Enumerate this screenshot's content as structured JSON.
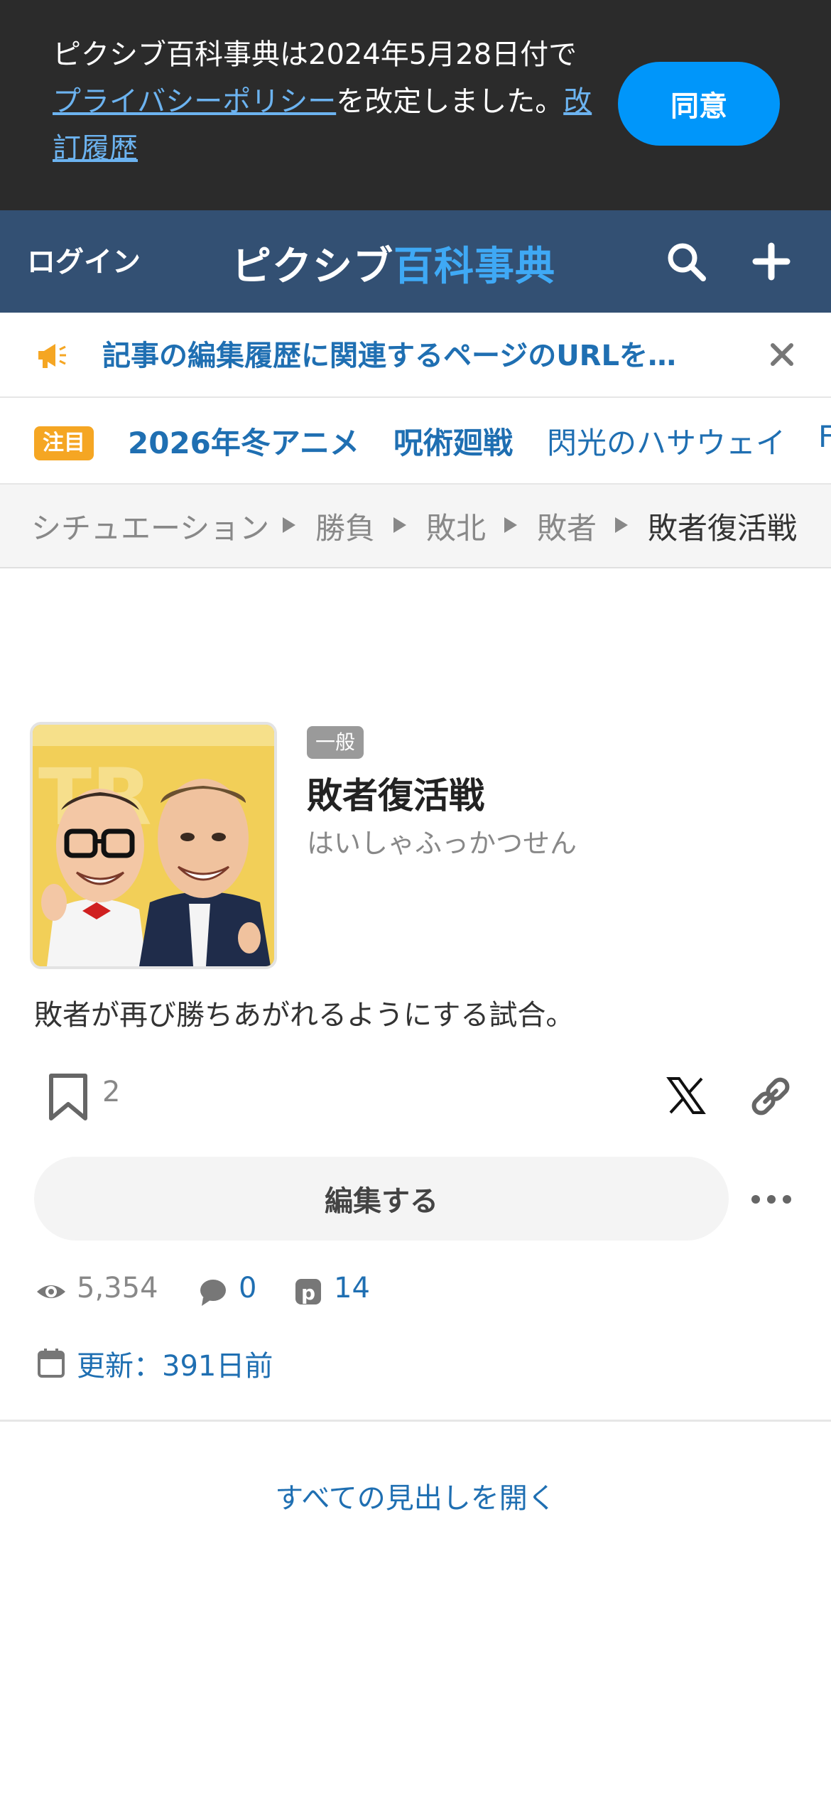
{
  "privacy_banner": {
    "text_1": "ピクシブ百科事典は2024年5月28日付で",
    "link_policy": "プライバシーポリシー",
    "text_2": "を改定しました。",
    "link_history": "改訂履歴",
    "agree_label": "同意"
  },
  "header": {
    "login_label": "ログイン",
    "logo_part_1": "ピクシブ",
    "logo_part_2": "百科事典",
    "search_icon": "search-icon",
    "add_icon": "plus-icon"
  },
  "notice": {
    "text": "記事の編集履歴に関連するページのURLを…",
    "icon": "megaphone-icon",
    "close_icon": "close-icon"
  },
  "trending": {
    "badge": "注目",
    "items": [
      "2026年冬アニメ",
      "呪術廻戦",
      "閃光のハサウェイ",
      "F"
    ]
  },
  "breadcrumb": {
    "items": [
      "シチュエーション",
      "勝負",
      "敗北",
      "敗者",
      "敗者復活戦"
    ]
  },
  "article": {
    "category_tag": "一般",
    "title": "敗者復活戦",
    "reading": "はいしゃふっかつせん",
    "summary": "敗者が再び勝ちあがれるようにする試合。",
    "bookmark_count": "2",
    "edit_label": "編集する",
    "views": "5,354",
    "comments": "0",
    "pixiv_works": "14",
    "updated": "更新：391日前"
  },
  "open_all_label": "すべての見出しを開く",
  "colors": {
    "header_bg": "#335073",
    "banner_bg": "#2b2b2b",
    "agree_button": "#0096fa",
    "link_blue": "#1f6fb2",
    "attention_badge": "#f5a623"
  }
}
